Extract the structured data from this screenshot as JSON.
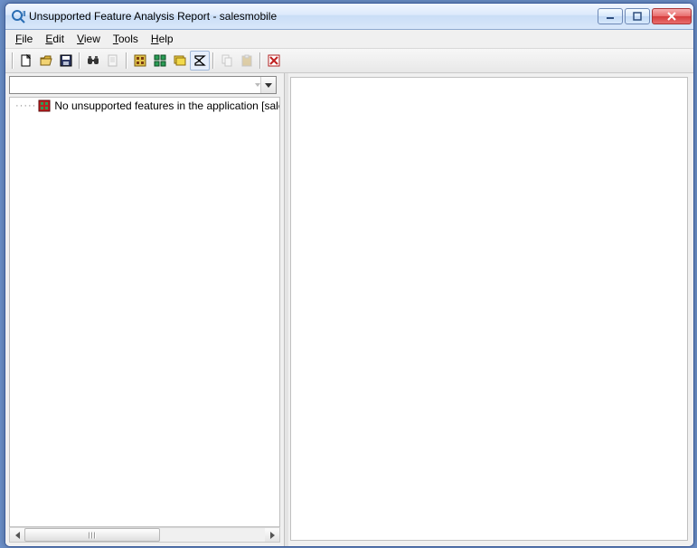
{
  "window": {
    "title": "Unsupported Feature Analysis Report - salesmobile"
  },
  "menu": {
    "file": "File",
    "edit": "Edit",
    "view": "View",
    "tools": "Tools",
    "help": "Help"
  },
  "toolbar": {
    "new": "new",
    "open": "open",
    "save": "save",
    "find": "find",
    "page": "page",
    "categories": "categories",
    "tiles": "tiles",
    "stack": "stack",
    "sigma": "sigma",
    "copy": "copy",
    "paste": "paste",
    "delete": "delete"
  },
  "combo": {
    "value": ""
  },
  "tree": {
    "items": [
      {
        "label": "No unsupported features in the application [salesmobi"
      }
    ]
  }
}
